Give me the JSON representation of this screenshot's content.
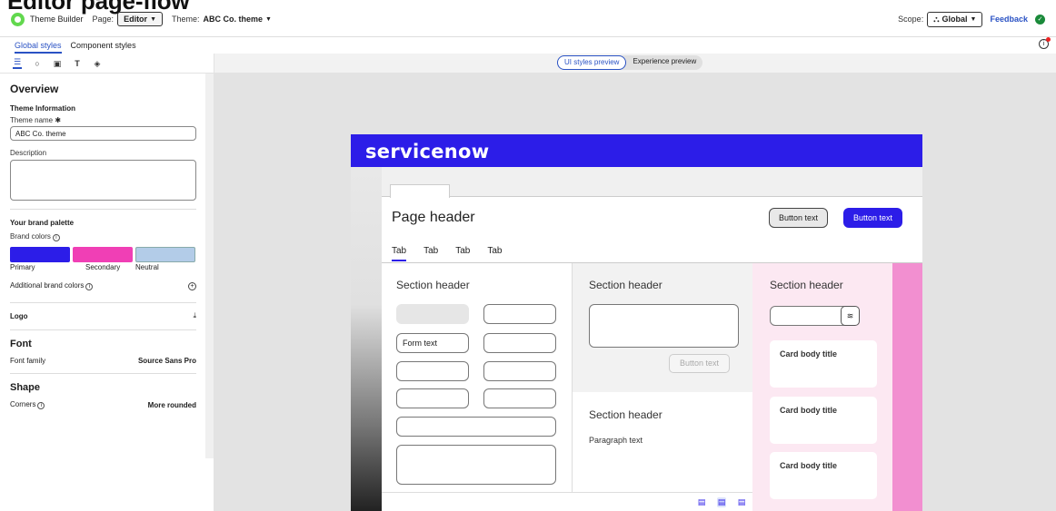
{
  "page_title": "Editor page-flow",
  "topbar": {
    "app_name": "Theme Builder",
    "page_label": "Page:",
    "page_value": "Editor",
    "theme_label": "Theme:",
    "theme_value": "ABC Co. theme",
    "scope_label": "Scope:",
    "scope_value": "Global",
    "feedback": "Feedback"
  },
  "style_tabs": [
    "Global styles",
    "Component styles"
  ],
  "preview_modes": [
    "UI styles preview",
    "Experience preview"
  ],
  "left_panel": {
    "overview": "Overview",
    "theme_info": "Theme Information",
    "theme_name_label": "Theme name",
    "theme_name_required": "✱",
    "theme_name_value": "ABC Co. theme",
    "description_label": "Description",
    "brand_palette": "Your brand palette",
    "brand_colors_label": "Brand colors",
    "swatches": [
      {
        "name": "Primary",
        "color": "#2c1de8"
      },
      {
        "name": "Secondary",
        "color": "#f03fb5"
      },
      {
        "name": "Neutral",
        "color": "#b3cce8"
      }
    ],
    "additional_colors": "Additional brand colors",
    "logo": "Logo",
    "font_heading": "Font",
    "font_family_label": "Font family",
    "font_family_value": "Source Sans Pro",
    "shape_heading": "Shape",
    "corners_label": "Corners",
    "corners_value": "More rounded"
  },
  "preview": {
    "brand_logo": "servicenow",
    "page_header": "Page header",
    "button_secondary": "Button text",
    "button_primary": "Button text",
    "tabs": [
      "Tab",
      "Tab",
      "Tab",
      "Tab"
    ],
    "section_header": "Section header",
    "form_text": "Form text",
    "button_disabled": "Button text",
    "paragraph": "Paragraph text",
    "card_title": "Card body title"
  },
  "colors": {
    "accent": "#2a52c4",
    "brand_primary": "#2c1de8",
    "brand_secondary": "#f03fb5",
    "neutral": "#b3cce8"
  }
}
